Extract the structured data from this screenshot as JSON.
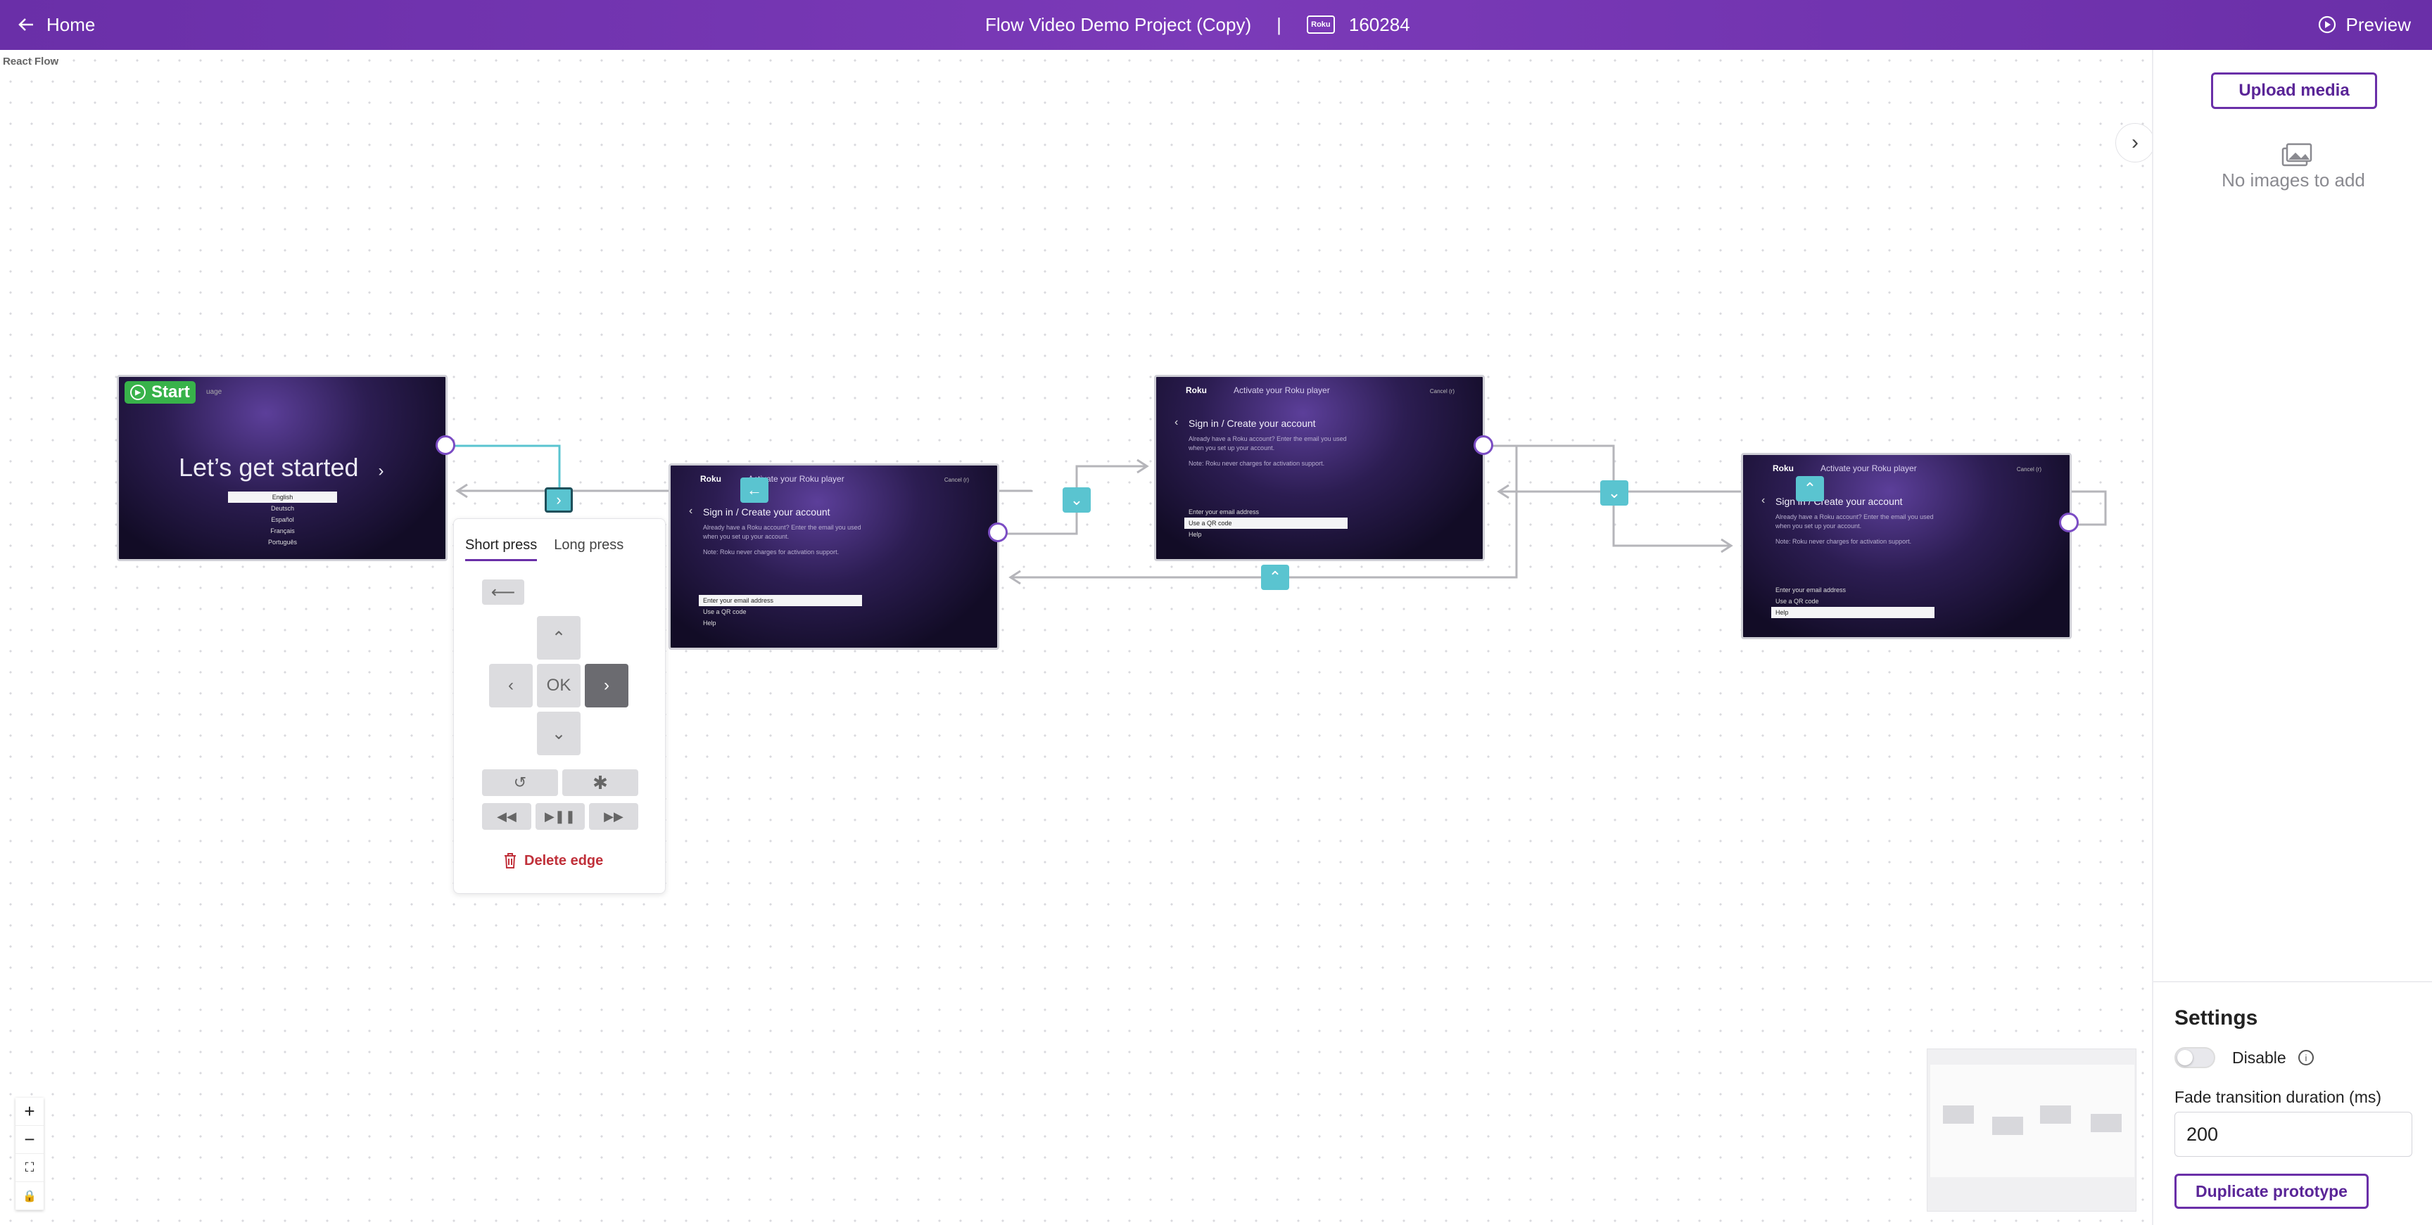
{
  "topbar": {
    "home_label": "Home",
    "project_title": "Flow Video Demo Project (Copy)",
    "separator": "|",
    "device_badge": "Roku",
    "device_id": "160284",
    "preview_label": "Preview"
  },
  "canvas": {
    "library_label": "React Flow"
  },
  "nodes": {
    "language": {
      "start_label": "Start",
      "header": "uage",
      "title": "Let’s get started",
      "languages": [
        "English",
        "Deutsch",
        "Español",
        "Français",
        "Português"
      ],
      "selected_index": 0
    },
    "screen1": {
      "brand": "Roku",
      "header": "Activate your Roku player",
      "cancel": "Cancel (r)",
      "title": "Sign in / Create your account",
      "body": "Already have a Roku account? Enter the email you used when you set up your account.",
      "note": "Note: Roku never charges for activation support.",
      "options": [
        "Enter your email address",
        "Use a QR code",
        "Help"
      ],
      "selected_index": 0
    },
    "screen2": {
      "brand": "Roku",
      "header": "Activate your Roku player",
      "cancel": "Cancel (r)",
      "title": "Sign in / Create your account",
      "body": "Already have a Roku account? Enter the email you used when you set up your account.",
      "note": "Note: Roku never charges for activation support.",
      "options": [
        "Enter your email address",
        "Use a QR code",
        "Help"
      ],
      "selected_index": 1
    },
    "screen3": {
      "brand": "Roku",
      "header": "Activate your Roku player",
      "cancel": "Cancel (r)",
      "title": "Sign in / Create your account",
      "body": "Already have a Roku account? Enter the email you used when you set up your account.",
      "note": "Note: Roku never charges for activation support.",
      "options": [
        "Enter your email address",
        "Use a QR code",
        "Help"
      ],
      "selected_index": 2
    }
  },
  "edge_popover": {
    "tabs": [
      "Short press",
      "Long press"
    ],
    "active_tab": 0,
    "ok_label": "OK",
    "selected_key": "right",
    "delete_label": "Delete edge"
  },
  "sidebar": {
    "upload_label": "Upload media",
    "empty_text": "No images to add",
    "settings": {
      "title": "Settings",
      "disable_label": "Disable",
      "disable_enabled": false,
      "fade_label": "Fade transition duration (ms)",
      "fade_value": "200",
      "duplicate_label": "Duplicate prototype"
    }
  },
  "colors": {
    "brand": "#6a2fa8",
    "edge_button": "#5ac4d0",
    "start_badge": "#38b24a",
    "delete": "#c0303a"
  }
}
